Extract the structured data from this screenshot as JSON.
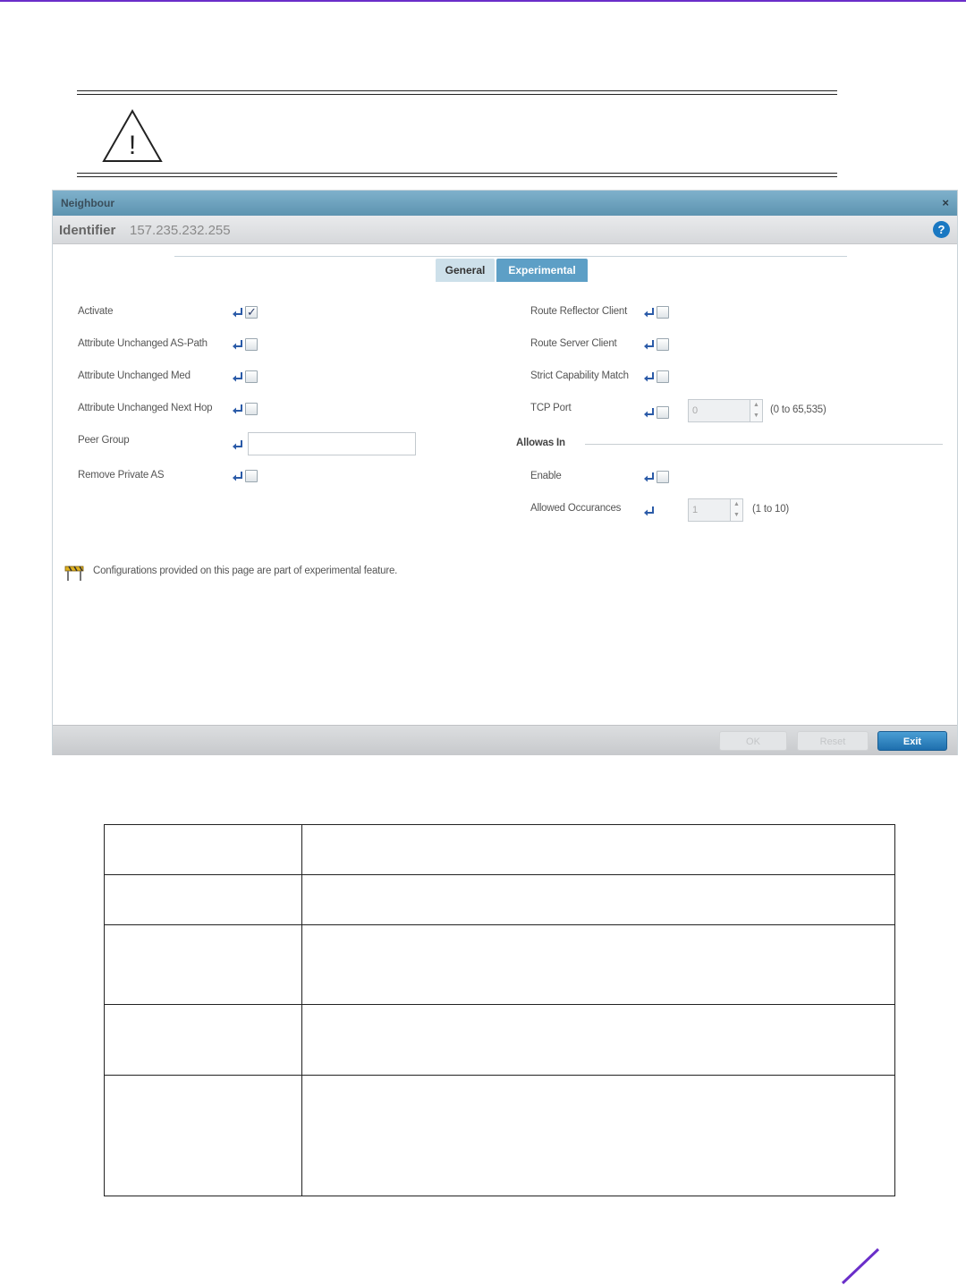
{
  "dialog": {
    "title": "Neighbour",
    "close_label": "×",
    "identifier_label": "Identifier",
    "identifier_value": "157.235.232.255",
    "help_label": "?"
  },
  "tabs": [
    {
      "label": "General",
      "selected": false
    },
    {
      "label": "Experimental",
      "selected": true
    }
  ],
  "left_fields": {
    "activate": {
      "label": "Activate",
      "checked": true
    },
    "attr_as_path": {
      "label": "Attribute Unchanged AS-Path",
      "checked": false
    },
    "attr_med": {
      "label": "Attribute Unchanged Med",
      "checked": false
    },
    "attr_next_hop": {
      "label": "Attribute Unchanged Next Hop",
      "checked": false
    },
    "peer_group": {
      "label": "Peer Group",
      "value": ""
    },
    "remove_private_as": {
      "label": "Remove Private AS",
      "checked": false
    }
  },
  "right_fields": {
    "route_reflector_client": {
      "label": "Route Reflector Client",
      "checked": false
    },
    "route_server_client": {
      "label": "Route Server Client",
      "checked": false
    },
    "strict_capability_match": {
      "label": "Strict Capability Match",
      "checked": false
    },
    "tcp_port": {
      "label": "TCP Port",
      "value": "0",
      "range": "(0 to 65,535)"
    }
  },
  "allowas_in": {
    "heading": "Allowas In",
    "enable": {
      "label": "Enable",
      "checked": false
    },
    "allowed_occurances": {
      "label": "Allowed Occurances",
      "value": "1",
      "range": "(1 to 10)"
    }
  },
  "note": "Configurations provided on this page are part of experimental feature.",
  "footer": {
    "ok_label": "OK",
    "reset_label": "Reset",
    "exit_label": "Exit"
  },
  "colors": {
    "accent_purple": "#6a2ec9",
    "titlebar_blue": "#5d93b0",
    "exit_blue": "#1e6fae"
  }
}
